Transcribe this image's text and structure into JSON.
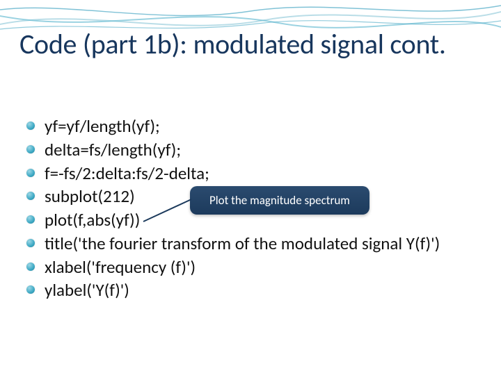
{
  "slide": {
    "title": "Code (part 1b): modulated signal cont.",
    "bullets": [
      "yf=yf/length(yf);",
      "delta=fs/length(yf);",
      "f=-fs/2:delta:fs/2-delta;",
      "subplot(212)",
      "plot(f,abs(yf))",
      "title('the fourier transform of the modulated signal Y(f)')",
      "xlabel('frequency (f)')",
      "ylabel('Y(f)')"
    ],
    "callout": "Plot the magnitude spectrum"
  },
  "colors": {
    "title": "#17365d",
    "callout_bg": "#1c3a5c",
    "bullet_accent": "#3da9c4"
  }
}
